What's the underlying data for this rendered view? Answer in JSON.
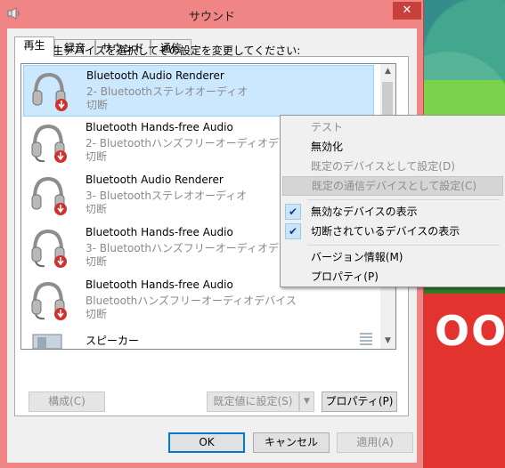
{
  "window": {
    "title": "サウンド",
    "close_glyph": "✕"
  },
  "tabs": [
    {
      "label": "再生",
      "active": true
    },
    {
      "label": "録音",
      "active": false
    },
    {
      "label": "サウンド",
      "active": false
    },
    {
      "label": "通信",
      "active": false
    }
  ],
  "instruction": "下の再生デバイスを選択してその設定を変更してください:",
  "devices": [
    {
      "name": "Bluetooth Audio Renderer",
      "desc": "2- Bluetoothステレオオーディオ",
      "status": "切断",
      "icon": "headset-icon",
      "selected": true
    },
    {
      "name": "Bluetooth Hands-free Audio",
      "desc": "2- Bluetoothハンズフリーオーディオデバイス",
      "status": "切断",
      "icon": "headset-icon",
      "selected": false
    },
    {
      "name": "Bluetooth Audio Renderer",
      "desc": "3- Bluetoothステレオオーディオ",
      "status": "切断",
      "icon": "headset-icon",
      "selected": false
    },
    {
      "name": "Bluetooth Hands-free Audio",
      "desc": "3- Bluetoothハンズフリーオーディオデバイス",
      "status": "切断",
      "icon": "headset-icon",
      "selected": false
    },
    {
      "name": "Bluetooth Hands-free Audio",
      "desc": "Bluetoothハンズフリーオーディオデバイス",
      "status": "切断",
      "icon": "headset-icon",
      "selected": false
    }
  ],
  "speaker": {
    "name": "スピーカー",
    "icon": "speaker-icon"
  },
  "buttons": {
    "configure": "構成(C)",
    "set_default": "既定値に設定(S)",
    "properties": "プロパティ(P)",
    "ok": "OK",
    "cancel": "キャンセル",
    "apply": "適用(A)"
  },
  "context_menu": {
    "items": [
      {
        "label": "テスト",
        "disabled": true,
        "checked": false
      },
      {
        "label": "無効化",
        "disabled": false,
        "checked": false
      },
      {
        "label": "既定のデバイスとして設定(D)",
        "disabled": true,
        "checked": false
      },
      {
        "label": "既定の通信デバイスとして設定(C)",
        "disabled": true,
        "checked": false,
        "highlighted": true
      },
      {
        "label": "無効なデバイスの表示",
        "disabled": false,
        "checked": true
      },
      {
        "label": "切断されているデバイスの表示",
        "disabled": false,
        "checked": true
      },
      {
        "label": "バージョン情報(M)",
        "disabled": false,
        "checked": false
      },
      {
        "label": "プロパティ(P)",
        "disabled": false,
        "checked": false
      }
    ],
    "check_glyph": "✔"
  },
  "background": {
    "text": "OO"
  },
  "colors": {
    "titlebar": "#f08585",
    "close": "#c7403b",
    "selected_row": "#cce8ff"
  }
}
